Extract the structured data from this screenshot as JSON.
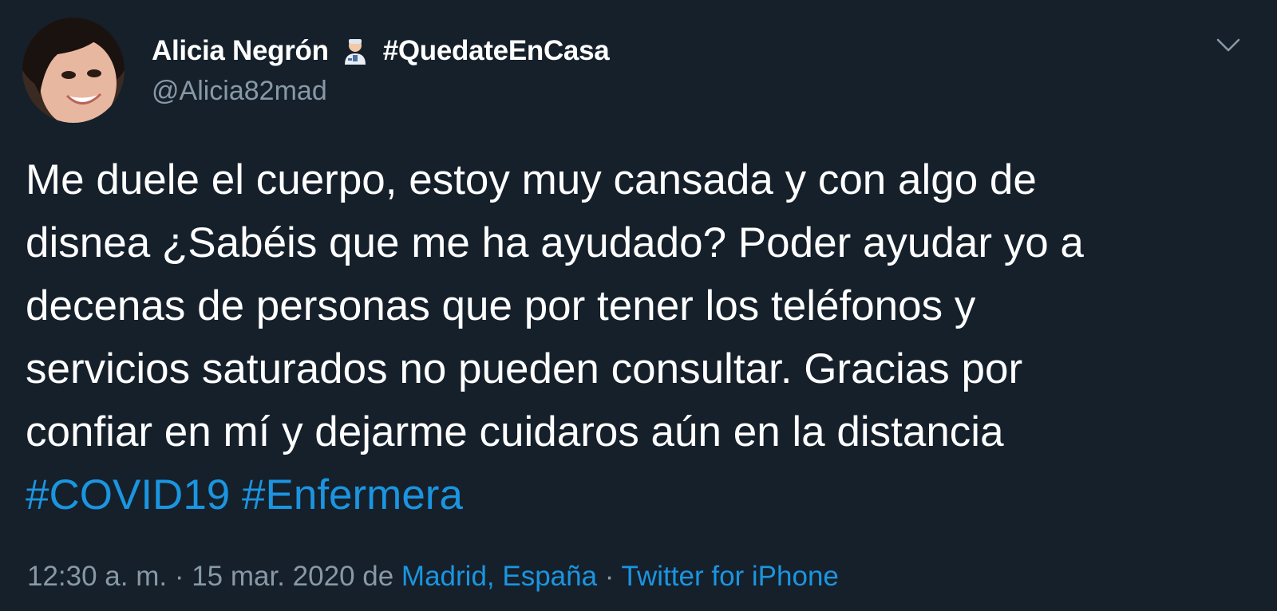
{
  "theme": {
    "background": "#15202b",
    "text_primary": "#ffffff",
    "text_secondary": "#8899a6",
    "accent": "#1b95e0"
  },
  "author": {
    "display_name": "Alicia Negrón",
    "emoji_icon": "health-worker-emoji",
    "hashtag_name": "#QuedateEnCasa",
    "handle": "@Alicia82mad"
  },
  "menu": {
    "icon": "chevron-down-icon"
  },
  "tweet": {
    "lines": [
      "Me duele el cuerpo, estoy muy cansada y con algo de",
      "disnea ¿Sabéis que me ha ayudado? Poder ayudar yo a",
      "decenas de personas que por tener los teléfonos y",
      "servicios saturados no pueden consultar. Gracias por",
      "confiar en mí y dejarme cuidaros aún en la distancia"
    ],
    "hashtags": [
      "#COVID19",
      "#Enfermera"
    ]
  },
  "meta": {
    "time": "12:30 a. m.",
    "separator": " · ",
    "date": "15 mar. 2020",
    "de_label": " de ",
    "location": "Madrid, España",
    "separator2": " · ",
    "source": "Twitter for iPhone"
  }
}
